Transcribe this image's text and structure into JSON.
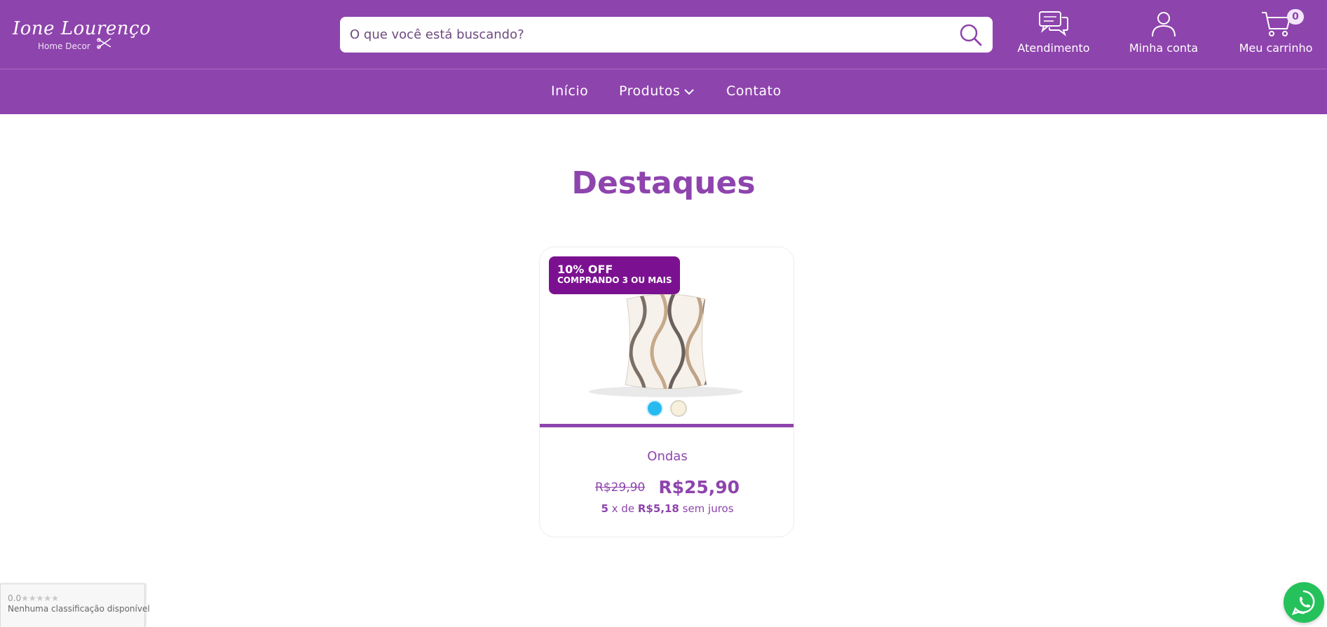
{
  "brand": {
    "name": "Ione Lourenço",
    "tagline": "Home Decor"
  },
  "search": {
    "placeholder": "O que você está buscando?"
  },
  "header_actions": {
    "support_label": "Atendimento",
    "account_label": "Minha conta",
    "cart_label": "Meu carrinho",
    "cart_count": "0"
  },
  "nav": {
    "items": [
      {
        "label": "Início"
      },
      {
        "label": "Produtos"
      },
      {
        "label": "Contato"
      }
    ]
  },
  "featured": {
    "title": "Destaques",
    "product": {
      "promo_line1": "10% OFF",
      "promo_line2": "COMPRANDO 3 OU MAIS",
      "name": "Ondas",
      "old_price": "R$29,90",
      "price": "R$25,90",
      "installments_count": "5",
      "installments_sep": "x de",
      "installments_value": "R$5,18",
      "installments_suffix": "sem juros",
      "color_options": [
        "#26baf0",
        "#f7f0dc"
      ]
    }
  },
  "rating_widget": {
    "score": "0.0",
    "text": "Nenhuma classificação disponível"
  },
  "colors": {
    "brand_purple": "#8e44ad",
    "promo_badge": "#7b1190",
    "whatsapp_green": "#25c15b"
  }
}
